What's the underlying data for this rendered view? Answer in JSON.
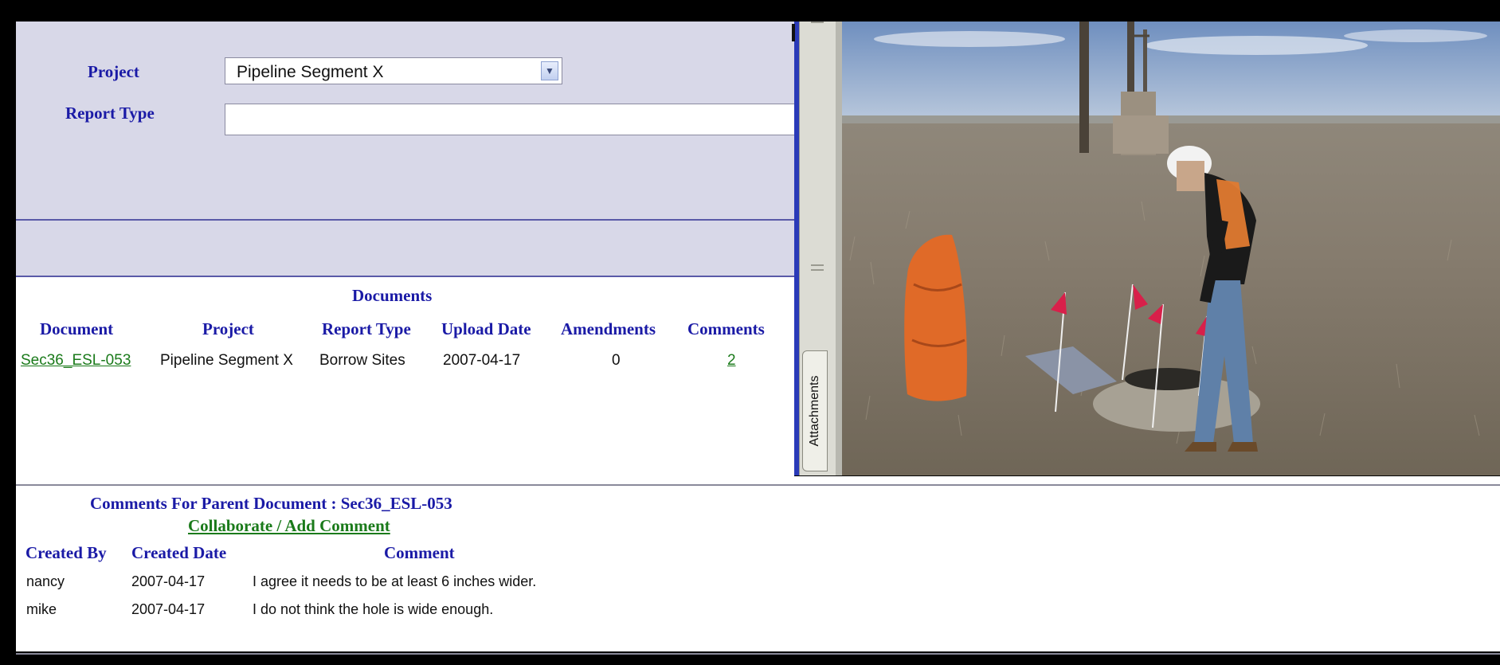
{
  "form": {
    "project_label": "Project",
    "project_value": "Pipeline Segment X",
    "report_type_label": "Report Type",
    "report_type_value": ""
  },
  "documents": {
    "title": "Documents",
    "columns": [
      "Document",
      "Project",
      "Report Type",
      "Upload Date",
      "Amendments",
      "Comments"
    ],
    "rows": [
      {
        "document": "Sec36_ESL-053",
        "project": "Pipeline Segment X",
        "report_type": "Borrow Sites",
        "upload_date": "2007-04-17",
        "amendments": "0",
        "comments": "2"
      }
    ]
  },
  "attachments": {
    "tab_label": "Attachments"
  },
  "comments": {
    "title": "Comments For Parent Document : Sec36_ESL-053",
    "action_link": "Collaborate / Add Comment",
    "columns": [
      "Created By",
      "Created Date",
      "Comment"
    ],
    "rows": [
      {
        "created_by": "nancy",
        "created_date": "2007-04-17",
        "comment": "I agree it needs to be at least 6 inches wider."
      },
      {
        "created_by": "mike",
        "created_date": "2007-04-17",
        "comment": "I do not think the hole is wide enough."
      }
    ]
  },
  "colors": {
    "panel_bg": "#d8d8e8",
    "header_text": "#1a1aa6",
    "link": "#1a7a1a",
    "splitter": "#2a3ab8"
  }
}
